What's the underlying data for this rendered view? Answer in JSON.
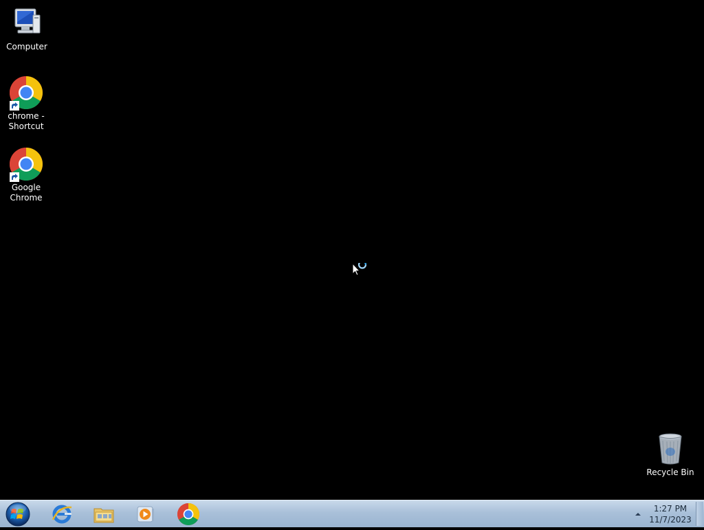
{
  "desktop": {
    "icons": [
      {
        "label": "Computer",
        "icon": "computer-icon"
      },
      {
        "label": "chrome - Shortcut",
        "icon": "chrome-icon"
      },
      {
        "label": "Google Chrome",
        "icon": "chrome-icon"
      },
      {
        "label": "Recycle Bin",
        "icon": "recycle-bin-icon"
      }
    ]
  },
  "taskbar": {
    "start_button": "windows-start-orb",
    "pinned": [
      {
        "name": "Internet Explorer",
        "icon": "internet-explorer-icon"
      },
      {
        "name": "Windows Explorer",
        "icon": "folder-icon"
      },
      {
        "name": "Windows Media Player",
        "icon": "media-player-icon"
      },
      {
        "name": "Google Chrome",
        "icon": "chrome-icon"
      }
    ],
    "tray": {
      "time": "1:27 PM",
      "date": "11/7/2023"
    }
  },
  "cursor": {
    "state": "busy"
  },
  "colors": {
    "desktop_background": "#000000",
    "taskbar_top": "#c9d9ea",
    "taskbar_bottom": "#9ab4d0",
    "chrome_red": "#db4437",
    "chrome_yellow": "#f4c20d",
    "chrome_green": "#0f9d58",
    "chrome_blue": "#4285f4"
  }
}
